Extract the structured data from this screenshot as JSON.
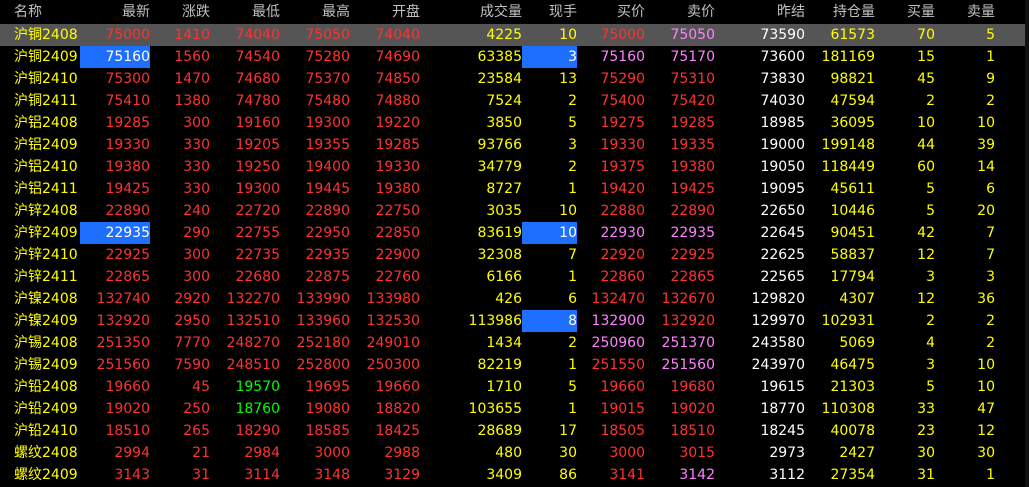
{
  "colors": {
    "red": "#FF3232",
    "green": "#00FF00",
    "yellow": "#FFFF00",
    "magenta": "#FF80FF",
    "white": "#FFFFFF",
    "header": "#C0C0C0",
    "highlight_bg": "#1E6FFF",
    "selected_bg": "#555555"
  },
  "headers": [
    "名称",
    "最新",
    "涨跌",
    "最低",
    "最高",
    "开盘",
    "成交量",
    "现手",
    "买价",
    "卖价",
    "昨结",
    "持仓量",
    "买量",
    "卖量"
  ],
  "rows": [
    {
      "name": "沪铜2408",
      "last": "75000",
      "change": "1410",
      "low": "74040",
      "high": "75050",
      "open": "74040",
      "volume": "4225",
      "cur": "10",
      "bid": "75000",
      "ask": "75050",
      "prev": "73590",
      "oi": "61573",
      "bidvol": "70",
      "askvol": "5",
      "low_color": "red",
      "bid_color": "red",
      "ask_color": "magenta"
    },
    {
      "name": "沪铜2409",
      "last": "75160",
      "change": "1560",
      "low": "74540",
      "high": "75280",
      "open": "74690",
      "volume": "63385",
      "cur": "3",
      "bid": "75160",
      "ask": "75170",
      "prev": "73600",
      "oi": "181169",
      "bidvol": "15",
      "askvol": "1",
      "low_color": "red",
      "bid_color": "magenta",
      "ask_color": "magenta"
    },
    {
      "name": "沪铜2410",
      "last": "75300",
      "change": "1470",
      "low": "74680",
      "high": "75370",
      "open": "74850",
      "volume": "23584",
      "cur": "13",
      "bid": "75290",
      "ask": "75310",
      "prev": "73830",
      "oi": "98821",
      "bidvol": "45",
      "askvol": "9",
      "low_color": "red",
      "bid_color": "red",
      "ask_color": "red"
    },
    {
      "name": "沪铜2411",
      "last": "75410",
      "change": "1380",
      "low": "74780",
      "high": "75480",
      "open": "74880",
      "volume": "7524",
      "cur": "2",
      "bid": "75400",
      "ask": "75420",
      "prev": "74030",
      "oi": "47594",
      "bidvol": "2",
      "askvol": "2",
      "low_color": "red",
      "bid_color": "red",
      "ask_color": "red"
    },
    {
      "name": "沪铝2408",
      "last": "19285",
      "change": "300",
      "low": "19160",
      "high": "19300",
      "open": "19220",
      "volume": "3850",
      "cur": "5",
      "bid": "19275",
      "ask": "19285",
      "prev": "18985",
      "oi": "36095",
      "bidvol": "10",
      "askvol": "10",
      "low_color": "red",
      "bid_color": "red",
      "ask_color": "red"
    },
    {
      "name": "沪铝2409",
      "last": "19330",
      "change": "330",
      "low": "19205",
      "high": "19355",
      "open": "19285",
      "volume": "93766",
      "cur": "3",
      "bid": "19330",
      "ask": "19335",
      "prev": "19000",
      "oi": "199148",
      "bidvol": "44",
      "askvol": "39",
      "low_color": "red",
      "bid_color": "red",
      "ask_color": "red"
    },
    {
      "name": "沪铝2410",
      "last": "19380",
      "change": "330",
      "low": "19250",
      "high": "19400",
      "open": "19330",
      "volume": "34779",
      "cur": "2",
      "bid": "19375",
      "ask": "19380",
      "prev": "19050",
      "oi": "118449",
      "bidvol": "60",
      "askvol": "14",
      "low_color": "red",
      "bid_color": "red",
      "ask_color": "red"
    },
    {
      "name": "沪铝2411",
      "last": "19425",
      "change": "330",
      "low": "19300",
      "high": "19445",
      "open": "19380",
      "volume": "8727",
      "cur": "1",
      "bid": "19420",
      "ask": "19425",
      "prev": "19095",
      "oi": "45611",
      "bidvol": "5",
      "askvol": "6",
      "low_color": "red",
      "bid_color": "red",
      "ask_color": "red"
    },
    {
      "name": "沪锌2408",
      "last": "22890",
      "change": "240",
      "low": "22720",
      "high": "22890",
      "open": "22750",
      "volume": "3035",
      "cur": "10",
      "bid": "22880",
      "ask": "22890",
      "prev": "22650",
      "oi": "10446",
      "bidvol": "5",
      "askvol": "20",
      "low_color": "red",
      "bid_color": "red",
      "ask_color": "red"
    },
    {
      "name": "沪锌2409",
      "last": "22935",
      "change": "290",
      "low": "22755",
      "high": "22950",
      "open": "22850",
      "volume": "83619",
      "cur": "10",
      "bid": "22930",
      "ask": "22935",
      "prev": "22645",
      "oi": "90451",
      "bidvol": "42",
      "askvol": "7",
      "low_color": "red",
      "bid_color": "magenta",
      "ask_color": "magenta"
    },
    {
      "name": "沪锌2410",
      "last": "22925",
      "change": "300",
      "low": "22735",
      "high": "22935",
      "open": "22900",
      "volume": "32308",
      "cur": "7",
      "bid": "22920",
      "ask": "22925",
      "prev": "22625",
      "oi": "58837",
      "bidvol": "12",
      "askvol": "7",
      "low_color": "red",
      "bid_color": "red",
      "ask_color": "red"
    },
    {
      "name": "沪锌2411",
      "last": "22865",
      "change": "300",
      "low": "22680",
      "high": "22875",
      "open": "22760",
      "volume": "6166",
      "cur": "1",
      "bid": "22860",
      "ask": "22865",
      "prev": "22565",
      "oi": "17794",
      "bidvol": "3",
      "askvol": "3",
      "low_color": "red",
      "bid_color": "red",
      "ask_color": "red"
    },
    {
      "name": "沪镍2408",
      "last": "132740",
      "change": "2920",
      "low": "132270",
      "high": "133990",
      "open": "133980",
      "volume": "426",
      "cur": "6",
      "bid": "132470",
      "ask": "132670",
      "prev": "129820",
      "oi": "4307",
      "bidvol": "12",
      "askvol": "36",
      "low_color": "red",
      "bid_color": "red",
      "ask_color": "red"
    },
    {
      "name": "沪镍2409",
      "last": "132920",
      "change": "2950",
      "low": "132510",
      "high": "133960",
      "open": "132530",
      "volume": "113986",
      "cur": "8",
      "bid": "132900",
      "ask": "132920",
      "prev": "129970",
      "oi": "102931",
      "bidvol": "2",
      "askvol": "2",
      "low_color": "red",
      "bid_color": "magenta",
      "ask_color": "red"
    },
    {
      "name": "沪锡2408",
      "last": "251350",
      "change": "7770",
      "low": "248270",
      "high": "252180",
      "open": "249010",
      "volume": "1434",
      "cur": "2",
      "bid": "250960",
      "ask": "251370",
      "prev": "243580",
      "oi": "5069",
      "bidvol": "4",
      "askvol": "2",
      "low_color": "red",
      "bid_color": "magenta",
      "ask_color": "magenta"
    },
    {
      "name": "沪锡2409",
      "last": "251560",
      "change": "7590",
      "low": "248510",
      "high": "252800",
      "open": "250300",
      "volume": "82219",
      "cur": "1",
      "bid": "251550",
      "ask": "251560",
      "prev": "243970",
      "oi": "46475",
      "bidvol": "3",
      "askvol": "10",
      "low_color": "red",
      "bid_color": "red",
      "ask_color": "magenta"
    },
    {
      "name": "沪铅2408",
      "last": "19660",
      "change": "45",
      "low": "19570",
      "high": "19695",
      "open": "19660",
      "volume": "1710",
      "cur": "5",
      "bid": "19660",
      "ask": "19680",
      "prev": "19615",
      "oi": "21303",
      "bidvol": "5",
      "askvol": "10",
      "low_color": "green",
      "bid_color": "red",
      "ask_color": "red"
    },
    {
      "name": "沪铅2409",
      "last": "19020",
      "change": "250",
      "low": "18760",
      "high": "19080",
      "open": "18820",
      "volume": "103655",
      "cur": "1",
      "bid": "19015",
      "ask": "19020",
      "prev": "18770",
      "oi": "110308",
      "bidvol": "33",
      "askvol": "47",
      "low_color": "green",
      "bid_color": "red",
      "ask_color": "red"
    },
    {
      "name": "沪铅2410",
      "last": "18510",
      "change": "265",
      "low": "18290",
      "high": "18585",
      "open": "18425",
      "volume": "28689",
      "cur": "17",
      "bid": "18505",
      "ask": "18510",
      "prev": "18245",
      "oi": "40078",
      "bidvol": "23",
      "askvol": "12",
      "low_color": "red",
      "bid_color": "red",
      "ask_color": "red"
    },
    {
      "name": "螺纹2408",
      "last": "2994",
      "change": "21",
      "low": "2984",
      "high": "3000",
      "open": "2988",
      "volume": "480",
      "cur": "30",
      "bid": "3000",
      "ask": "3015",
      "prev": "2973",
      "oi": "2427",
      "bidvol": "30",
      "askvol": "30",
      "low_color": "red",
      "bid_color": "red",
      "ask_color": "red"
    },
    {
      "name": "螺纹2409",
      "last": "3143",
      "change": "31",
      "low": "3114",
      "high": "3148",
      "open": "3129",
      "volume": "3409",
      "cur": "86",
      "bid": "3141",
      "ask": "3142",
      "prev": "3112",
      "oi": "27354",
      "bidvol": "31",
      "askvol": "1",
      "low_color": "red",
      "bid_color": "red",
      "ask_color": "magenta"
    }
  ]
}
